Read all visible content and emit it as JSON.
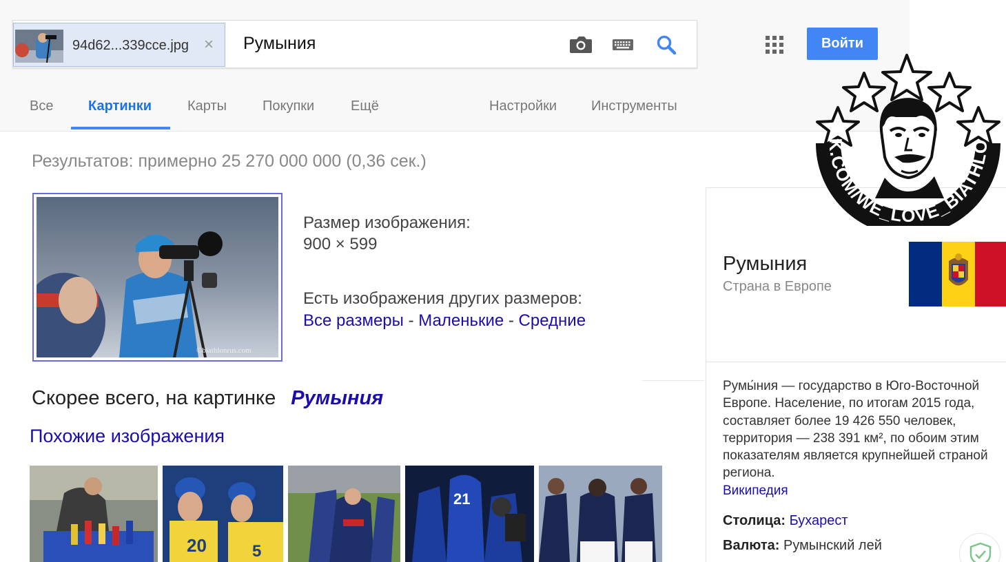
{
  "search": {
    "image_chip_name": "94d62...339cce.jpg",
    "image_chip_close": "×",
    "query": "Румыния",
    "icons": [
      "camera-icon",
      "keyboard-icon",
      "search-icon"
    ]
  },
  "header": {
    "apps_icon": "apps-grid-icon",
    "login_label": "Войти",
    "accent": "#4285f4"
  },
  "tabs": [
    {
      "label": "Все",
      "active": false
    },
    {
      "label": "Картинки",
      "active": true
    },
    {
      "label": "Карты",
      "active": false
    },
    {
      "label": "Покупки",
      "active": false
    },
    {
      "label": "Ещё",
      "active": false
    },
    {
      "label": "Настройки",
      "active": false
    },
    {
      "label": "Инструменты",
      "active": false
    }
  ],
  "results": {
    "count_text": "Результатов: примерно 25 270 000 000 (0,36 сек.)",
    "image_credit": "©biathlonrus.com",
    "size_label": "Размер изображения:",
    "size_value": "900 × 599",
    "other_sizes_label": "Есть изображения других размеров:",
    "size_links": [
      "Все размеры",
      "Маленькие",
      "Средние"
    ],
    "size_separator": " - ",
    "best_guess_prefix": "Скорее всего, на картинке",
    "best_guess_term": "Румыния",
    "similar_images_label": "Похожие изображения"
  },
  "knowledge_panel": {
    "title": "Румыния",
    "subtitle": "Страна в Европе",
    "flag_colors": [
      "#002b7f",
      "#fcd116",
      "#ce1126"
    ],
    "description": "Румы́ния — государство в Юго-Восточной Европе. Население, по итогам 2015 года, составляет более 19 426 550 человек, территория — 238 391 км², по обоим этим показателям является крупнейшей страной региона.",
    "source_link": "Википедия",
    "facts": [
      {
        "label": "Столица:",
        "value": "Бухарест",
        "is_link": true
      },
      {
        "label": "Валюта:",
        "value": "Румынский лей",
        "is_link": false
      }
    ]
  },
  "watermark": {
    "text": "VK.COM/WE_LOVE_BIATHLON"
  }
}
